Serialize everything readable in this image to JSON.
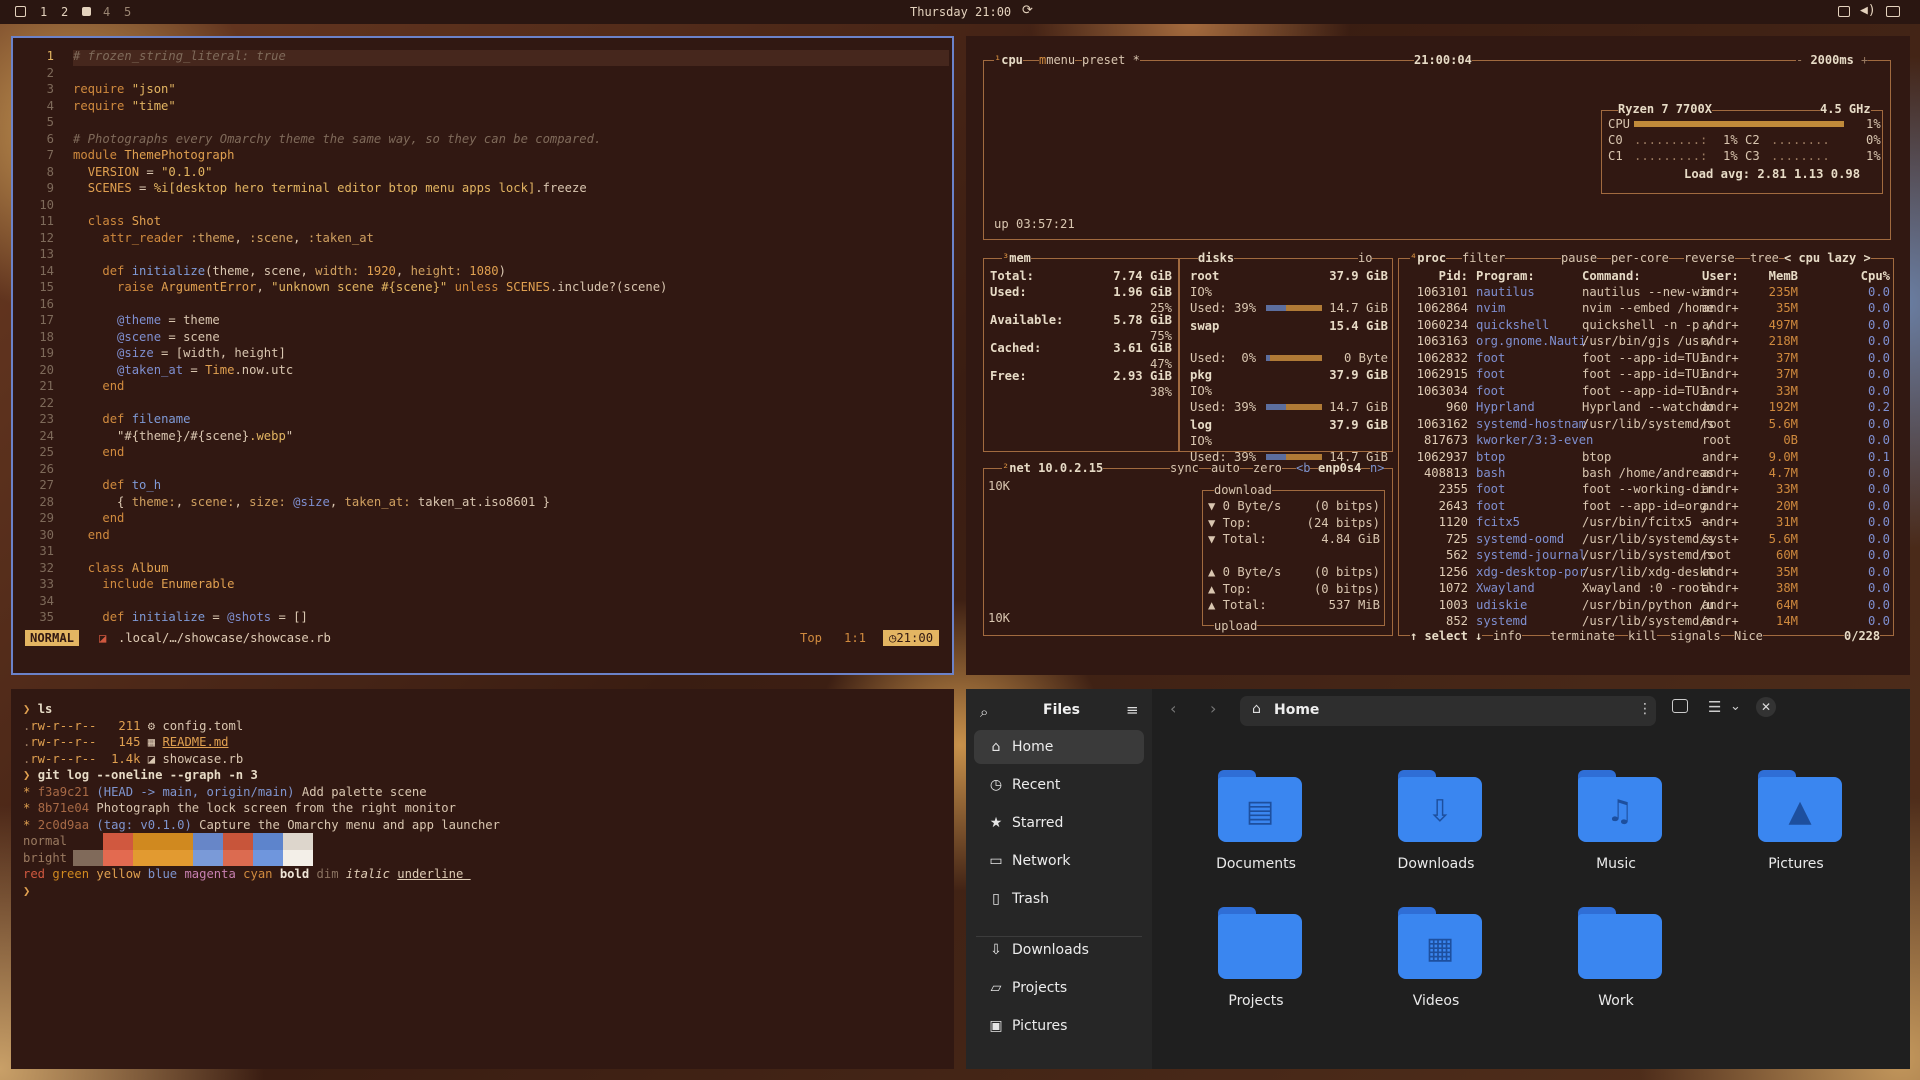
{
  "topbar": {
    "workspaces": [
      "1",
      "2",
      "4",
      "5"
    ],
    "datetime": "Thursday 21:00"
  },
  "nvim": {
    "lines": [
      {
        "n": "1",
        "parts": [
          [
            "cm",
            "# frozen_string_literal: true"
          ]
        ]
      },
      {
        "n": "2",
        "parts": []
      },
      {
        "n": "3",
        "parts": [
          [
            "kw",
            "require "
          ],
          [
            "str",
            "\"json\""
          ]
        ]
      },
      {
        "n": "4",
        "parts": [
          [
            "kw",
            "require "
          ],
          [
            "str",
            "\"time\""
          ]
        ]
      },
      {
        "n": "5",
        "parts": []
      },
      {
        "n": "6",
        "parts": [
          [
            "cm",
            "# Photographs every Omarchy theme the same way, so they can be compared."
          ]
        ]
      },
      {
        "n": "7",
        "parts": [
          [
            "kw",
            "module "
          ],
          [
            "cn",
            "ThemePhotograph"
          ]
        ]
      },
      {
        "n": "8",
        "parts": [
          [
            "",
            "  "
          ],
          [
            "cn",
            "VERSION"
          ],
          [
            "",
            " = "
          ],
          [
            "str",
            "\"0.1.0\""
          ]
        ]
      },
      {
        "n": "9",
        "parts": [
          [
            "",
            "  "
          ],
          [
            "cn",
            "SCENES"
          ],
          [
            "",
            " = "
          ],
          [
            "str",
            "%i[desktop hero terminal editor btop menu apps lock]"
          ],
          [
            "",
            ".freeze"
          ]
        ]
      },
      {
        "n": "10",
        "parts": []
      },
      {
        "n": "11",
        "parts": [
          [
            "",
            "  "
          ],
          [
            "kw",
            "class "
          ],
          [
            "cn",
            "Shot"
          ]
        ]
      },
      {
        "n": "12",
        "parts": [
          [
            "",
            "    "
          ],
          [
            "kw",
            "attr_reader "
          ],
          [
            "sym",
            ":theme"
          ],
          [
            "",
            ", "
          ],
          [
            "sym",
            ":scene"
          ],
          [
            "",
            ", "
          ],
          [
            "sym",
            ":taken_at"
          ]
        ]
      },
      {
        "n": "13",
        "parts": []
      },
      {
        "n": "14",
        "parts": [
          [
            "",
            "    "
          ],
          [
            "kw",
            "def "
          ],
          [
            "fn",
            "initialize"
          ],
          [
            "",
            "(theme, scene, "
          ],
          [
            "sym",
            "width:"
          ],
          [
            "",
            " "
          ],
          [
            "num",
            "1920"
          ],
          [
            "",
            ", "
          ],
          [
            "sym",
            "height:"
          ],
          [
            "",
            " "
          ],
          [
            "num",
            "1080"
          ],
          [
            "",
            ")"
          ]
        ]
      },
      {
        "n": "15",
        "parts": [
          [
            "",
            "      "
          ],
          [
            "kw",
            "raise "
          ],
          [
            "cn",
            "ArgumentError"
          ],
          [
            "",
            ", "
          ],
          [
            "str",
            "\"unknown scene #{scene}\""
          ],
          [
            "",
            " "
          ],
          [
            "kw",
            "unless "
          ],
          [
            "cn",
            "SCENES"
          ],
          [
            "",
            ".include?(scene)"
          ]
        ]
      },
      {
        "n": "16",
        "parts": []
      },
      {
        "n": "17",
        "parts": [
          [
            "",
            "      "
          ],
          [
            "ivar",
            "@theme"
          ],
          [
            "",
            " = theme"
          ]
        ]
      },
      {
        "n": "18",
        "parts": [
          [
            "",
            "      "
          ],
          [
            "ivar",
            "@scene"
          ],
          [
            "",
            " = scene"
          ]
        ]
      },
      {
        "n": "19",
        "parts": [
          [
            "",
            "      "
          ],
          [
            "ivar",
            "@size"
          ],
          [
            "",
            " = [width, height]"
          ]
        ]
      },
      {
        "n": "20",
        "parts": [
          [
            "",
            "      "
          ],
          [
            "ivar",
            "@taken_at"
          ],
          [
            "",
            " = "
          ],
          [
            "cn",
            "Time"
          ],
          [
            "",
            ".now.utc"
          ]
        ]
      },
      {
        "n": "21",
        "parts": [
          [
            "",
            "    "
          ],
          [
            "kw",
            "end"
          ]
        ]
      },
      {
        "n": "22",
        "parts": []
      },
      {
        "n": "23",
        "parts": [
          [
            "",
            "    "
          ],
          [
            "kw",
            "def "
          ],
          [
            "fn",
            "filename"
          ]
        ]
      },
      {
        "n": "24",
        "parts": [
          [
            "",
            "      "
          ],
          [
            "",
            "\"#{theme}/#{scene}"
          ],
          [
            "str",
            ".webp"
          ],
          [
            "",
            "\""
          ]
        ]
      },
      {
        "n": "25",
        "parts": [
          [
            "",
            "    "
          ],
          [
            "kw",
            "end"
          ]
        ]
      },
      {
        "n": "26",
        "parts": []
      },
      {
        "n": "27",
        "parts": [
          [
            "",
            "    "
          ],
          [
            "kw",
            "def "
          ],
          [
            "fn",
            "to_h"
          ]
        ]
      },
      {
        "n": "28",
        "parts": [
          [
            "",
            "      { "
          ],
          [
            "sym",
            "theme:"
          ],
          [
            "",
            ", "
          ],
          [
            "sym",
            "scene:"
          ],
          [
            "",
            ", "
          ],
          [
            "sym",
            "size:"
          ],
          [
            "",
            " "
          ],
          [
            "ivar",
            "@size"
          ],
          [
            "",
            ", "
          ],
          [
            "sym",
            "taken_at:"
          ],
          [
            "",
            " taken_at.iso8601 }"
          ]
        ]
      },
      {
        "n": "29",
        "parts": [
          [
            "",
            "    "
          ],
          [
            "kw",
            "end"
          ]
        ]
      },
      {
        "n": "30",
        "parts": [
          [
            "",
            "  "
          ],
          [
            "kw",
            "end"
          ]
        ]
      },
      {
        "n": "31",
        "parts": []
      },
      {
        "n": "32",
        "parts": [
          [
            "",
            "  "
          ],
          [
            "kw",
            "class "
          ],
          [
            "cn",
            "Album"
          ]
        ]
      },
      {
        "n": "33",
        "parts": [
          [
            "",
            "    "
          ],
          [
            "kw",
            "include "
          ],
          [
            "cn",
            "Enumerable"
          ]
        ]
      },
      {
        "n": "34",
        "parts": []
      },
      {
        "n": "35",
        "parts": [
          [
            "",
            "    "
          ],
          [
            "kw",
            "def "
          ],
          [
            "fn",
            "initialize"
          ],
          [
            "",
            " = "
          ],
          [
            "ivar",
            "@shots"
          ],
          [
            "",
            " = []"
          ]
        ]
      }
    ],
    "status": {
      "mode": "NORMAL",
      "path": ".local/…/showcase/showcase.rb",
      "pos": "Top",
      "cursor": "1:1",
      "clock": "21:00"
    }
  },
  "btop": {
    "cpu": {
      "tabs": [
        "cpu",
        "menu",
        "preset *"
      ],
      "clock": "21:00:04",
      "interval": "2000ms",
      "model": "Ryzen 7 7700X",
      "freq": "4.5 GHz",
      "rows": [
        {
          "label": "CPU",
          "val": "1%",
          "frac": 0.01
        },
        {
          "label": "C0",
          "val": "1%",
          "label2": "C2",
          "val2": "0%"
        },
        {
          "label": "C1",
          "val": "1%",
          "label2": "C3",
          "val2": "1%"
        }
      ],
      "load": "Load avg: 2.81 1.13 0.98",
      "uptime": "up 03:57:21"
    },
    "mem": {
      "title": "mem",
      "rows": [
        {
          "k": "Total:",
          "v": "7.74 GiB"
        },
        {
          "k": "Used:",
          "v": "1.96 GiB",
          "p": "25%"
        },
        {
          "k": "Available:",
          "v": "5.78 GiB",
          "p": "75%"
        },
        {
          "k": "Cached:",
          "v": "3.61 GiB",
          "p": "47%"
        },
        {
          "k": "Free:",
          "v": "2.93 GiB",
          "p": "38%"
        }
      ]
    },
    "disks": {
      "title": "disks",
      "io": "io",
      "groups": [
        {
          "name": "root",
          "size": "37.9 GiB",
          "io": "IO%",
          "used": "Used: 39%",
          "usedv": "14.7 GiB"
        },
        {
          "name": "swap",
          "size": "15.4 GiB",
          "io": "",
          "used": "Used:  0%",
          "usedv": "0 Byte"
        },
        {
          "name": "pkg",
          "size": "37.9 GiB",
          "io": "IO%",
          "used": "Used: 39%",
          "usedv": "14.7 GiB"
        },
        {
          "name": "log",
          "size": "37.9 GiB",
          "io": "IO%",
          "used": "Used: 39%",
          "usedv": "14.7 GiB"
        }
      ]
    },
    "net": {
      "title": "net",
      "ip": "10.0.2.15",
      "tabs": [
        "sync",
        "auto",
        "zero",
        "<b",
        "enp0s4",
        "n>"
      ],
      "scale_top": "10K",
      "scale_bottom": "10K",
      "download": "download",
      "upload": "upload",
      "down": [
        [
          "▼ 0 Byte/s",
          "(0 bitps)"
        ],
        [
          "▼ Top:",
          "(24 bitps)"
        ],
        [
          "▼ Total:",
          "4.84 GiB"
        ]
      ],
      "up": [
        [
          "▲ 0 Byte/s",
          "(0 bitps)"
        ],
        [
          "▲ Top:",
          "(0 bitps)"
        ],
        [
          "▲ Total:",
          "537 MiB"
        ]
      ]
    },
    "proc": {
      "tabs": [
        "proc",
        "filter",
        "pause",
        "per-core",
        "reverse",
        "tree",
        "< cpu lazy >"
      ],
      "header": [
        "Pid:",
        "Program:",
        "Command:",
        "User:",
        "MemB",
        "Cpu%"
      ],
      "rows": [
        [
          "1063101",
          "nautilus",
          "nautilus --new-win",
          "andr+",
          "235M",
          "0.0"
        ],
        [
          "1062864",
          "nvim",
          "nvim --embed /home",
          "andr+",
          "35M",
          "0.0"
        ],
        [
          "1060234",
          "quickshell",
          "quickshell -n -p /",
          "andr+",
          "497M",
          "0.0"
        ],
        [
          "1063163",
          "org.gnome.Nauti",
          "/usr/bin/gjs /usr/",
          "andr+",
          "218M",
          "0.0"
        ],
        [
          "1062832",
          "foot",
          "foot --app-id=TUI.",
          "andr+",
          "37M",
          "0.0"
        ],
        [
          "1062915",
          "foot",
          "foot --app-id=TUI.",
          "andr+",
          "37M",
          "0.0"
        ],
        [
          "1063034",
          "foot",
          "foot --app-id=TUI.",
          "andr+",
          "33M",
          "0.0"
        ],
        [
          "960",
          "Hyprland",
          "Hyprland --watchdo",
          "andr+",
          "192M",
          "0.2"
        ],
        [
          "1063162",
          "systemd-hostnam",
          "/usr/lib/systemd/s",
          "root",
          "5.6M",
          "0.0"
        ],
        [
          "817673",
          "kworker/3:3-even",
          "",
          "root",
          "0B",
          "0.0"
        ],
        [
          "1062937",
          "btop",
          "btop",
          "andr+",
          "9.0M",
          "0.1"
        ],
        [
          "408813",
          "bash",
          "bash /home/andreas",
          "andr+",
          "4.7M",
          "0.0"
        ],
        [
          "2355",
          "foot",
          "foot --working-dir",
          "andr+",
          "33M",
          "0.0"
        ],
        [
          "2643",
          "foot",
          "foot --app-id=org.",
          "andr+",
          "20M",
          "0.0"
        ],
        [
          "1120",
          "fcitx5",
          "/usr/bin/fcitx5 --",
          "andr+",
          "31M",
          "0.0"
        ],
        [
          "725",
          "systemd-oomd",
          "/usr/lib/systemd/s",
          "syst+",
          "5.6M",
          "0.0"
        ],
        [
          "562",
          "systemd-journal",
          "/usr/lib/systemd/s",
          "root",
          "60M",
          "0.0"
        ],
        [
          "1256",
          "xdg-desktop-por",
          "/usr/lib/xdg-deskt",
          "andr+",
          "35M",
          "0.0"
        ],
        [
          "1072",
          "Xwayland",
          "Xwayland :0 -rootl",
          "andr+",
          "38M",
          "0.0"
        ],
        [
          "1003",
          "udiskie",
          "/usr/bin/python /u",
          "andr+",
          "64M",
          "0.0"
        ],
        [
          "852",
          "systemd",
          "/usr/lib/systemd/s",
          "andr+",
          "14M",
          "0.0"
        ]
      ],
      "footer": [
        "↑ select ↓",
        "info",
        "terminate",
        "kill",
        "signals",
        "Nice"
      ],
      "count": "0/228"
    }
  },
  "term": {
    "ls_cmd": "ls",
    "files": [
      [
        "rw-r--r--",
        "211",
        "config.toml"
      ],
      [
        "rw-r--r--",
        "145",
        "README.md"
      ],
      [
        "rw-r--r--",
        "1.4k",
        "showcase.rb"
      ]
    ],
    "git_cmd": "git log --oneline --graph -n 3",
    "commits": [
      [
        "f3a9c21",
        "(HEAD -> main, origin/main)",
        "Add palette scene"
      ],
      [
        "8b71e04",
        "",
        "Photograph the lock screen from the right monitor"
      ],
      [
        "2c0d9aa",
        "(tag: v0.1.0)",
        "Capture the Omarchy menu and app launcher"
      ]
    ],
    "normal": "normal",
    "bright": "bright",
    "swatches_normal": [
      "#311812",
      "#d0583f",
      "#d0891f",
      "#d0891f",
      "#6786c8",
      "#c8553a",
      "#5d84cc",
      "#ddd6cc"
    ],
    "swatches_bright": [
      "#806a5a",
      "#e36a50",
      "#e29a30",
      "#e29a30",
      "#7a9ad8",
      "#dc6b50",
      "#6f96dd",
      "#f3efe8"
    ],
    "styles": [
      "red",
      "green",
      "yellow",
      "blue",
      "magenta",
      "cyan",
      "bold",
      "dim",
      "italic",
      "underline"
    ]
  },
  "files": {
    "title": "Files",
    "location": "Home",
    "sidebar": [
      {
        "label": "Home",
        "icon": "home-icon"
      },
      {
        "label": "Recent",
        "icon": "clock-icon"
      },
      {
        "label": "Starred",
        "icon": "star-icon"
      },
      {
        "label": "Network",
        "icon": "network-icon"
      },
      {
        "label": "Trash",
        "icon": "trash-icon"
      },
      {
        "label": "Downloads",
        "icon": "download-icon"
      },
      {
        "label": "Projects",
        "icon": "folder-icon"
      },
      {
        "label": "Pictures",
        "icon": "image-icon"
      }
    ],
    "folders": [
      {
        "name": "Documents",
        "icon": "document-icon"
      },
      {
        "name": "Downloads",
        "icon": "download-icon"
      },
      {
        "name": "Music",
        "icon": "music-icon"
      },
      {
        "name": "Pictures",
        "icon": "image-icon"
      },
      {
        "name": "Projects",
        "icon": ""
      },
      {
        "name": "Videos",
        "icon": "film-icon"
      },
      {
        "name": "Work",
        "icon": ""
      }
    ]
  }
}
